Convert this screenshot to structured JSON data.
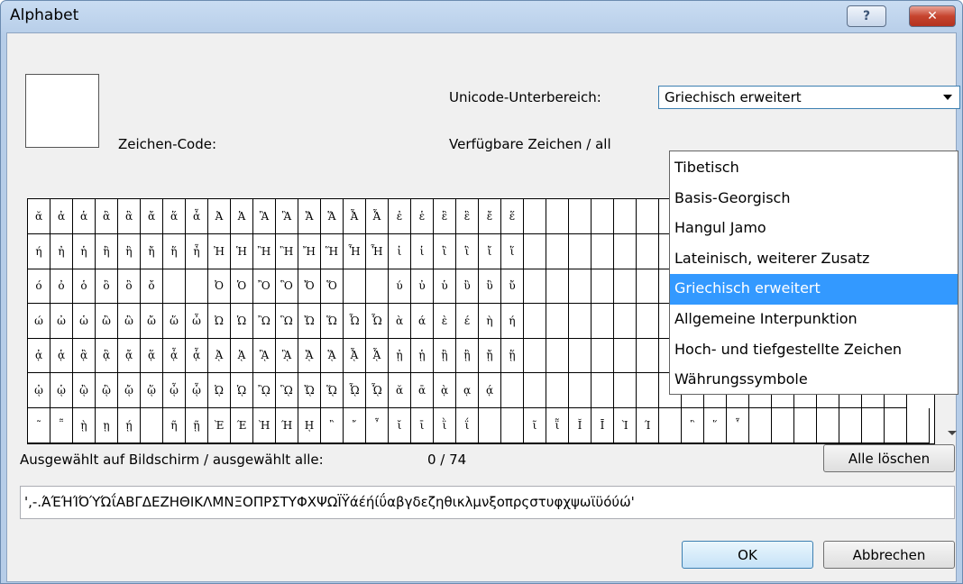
{
  "window": {
    "title": "Alphabet",
    "help_label": "?",
    "close_label": "✕"
  },
  "labels": {
    "unicode_label": "Unicode-Unterbereich:",
    "zeichen_code": "Zeichen-Code:",
    "verfuegbar": "Verfügbare Zeichen / all",
    "ausgewaehlt": "Ausgewählt auf Bildschirm / ausgewählt alle:",
    "count": "0 / 74"
  },
  "select": {
    "value": "Griechisch erweitert"
  },
  "dropdown": {
    "options": [
      "Tibetisch",
      "Basis-Georgisch",
      "Hangul Jamo",
      "Lateinisch, weiterer Zusatz",
      "Griechisch erweitert",
      "Allgemeine Interpunktion",
      "Hoch- und tiefgestellte Zeichen",
      "Währungssymbole"
    ],
    "selected_index": 4
  },
  "grid": {
    "rows": [
      [
        "ᾰ",
        "ἀ",
        "ἁ",
        "ἂ",
        "ἃ",
        "ἄ",
        "ἅ",
        "ἆ",
        "Ἀ",
        "Ἁ",
        "Ἂ",
        "Ἃ",
        "Ἄ",
        "Ἅ",
        "Ἆ",
        "Ἇ",
        "ἐ",
        "ἑ",
        "ἒ",
        "ἓ",
        "ἔ",
        "ἕ",
        "",
        "",
        "",
        "",
        "",
        "",
        "",
        "",
        "",
        "",
        "",
        "",
        "",
        "",
        "",
        "",
        "",
        ""
      ],
      [
        "ή",
        "ἠ",
        "ἡ",
        "ἢ",
        "ἣ",
        "ἤ",
        "ἥ",
        "ἦ",
        "Ἠ",
        "Ἡ",
        "Ἢ",
        "Ἣ",
        "Ἤ",
        "Ἥ",
        "Ἦ",
        "Ἧ",
        "ἰ",
        "ἱ",
        "ἲ",
        "ἳ",
        "ἴ",
        "ἵ",
        "",
        "",
        "",
        "",
        "",
        "",
        "",
        "",
        "",
        "",
        "",
        "",
        "",
        "",
        "",
        "",
        "",
        ""
      ],
      [
        "ό",
        "ὀ",
        "ὁ",
        "ὂ",
        "ὃ",
        "ὄ",
        "",
        "",
        "Ὀ",
        "Ὁ",
        "Ὂ",
        "Ὃ",
        "Ὄ",
        "Ὅ",
        "",
        "",
        "ύ",
        "ὐ",
        "ὑ",
        "ὒ",
        "ὓ",
        "ὔ",
        "",
        "",
        "",
        "",
        "",
        "",
        "",
        "",
        "",
        "",
        "",
        "",
        "",
        "",
        "",
        "",
        "",
        ""
      ],
      [
        "ώ",
        "ὠ",
        "ὡ",
        "ὢ",
        "ὣ",
        "ὤ",
        "ὥ",
        "ὦ",
        "Ὠ",
        "Ὡ",
        "Ὢ",
        "Ὣ",
        "Ὤ",
        "Ὥ",
        "Ὦ",
        "Ὧ",
        "ὰ",
        "ά",
        "ὲ",
        "έ",
        "ὴ",
        "ή",
        "",
        "",
        "",
        "",
        "",
        "",
        "",
        "",
        "",
        "",
        "",
        "",
        "",
        "",
        "",
        "",
        "",
        ""
      ],
      [
        "ᾀ",
        "ᾁ",
        "ᾂ",
        "ᾃ",
        "ᾄ",
        "ᾅ",
        "ᾆ",
        "ᾇ",
        "ᾈ",
        "ᾉ",
        "ᾊ",
        "ᾋ",
        "ᾌ",
        "ᾍ",
        "ᾎ",
        "ᾏ",
        "ᾐ",
        "ᾑ",
        "ᾒ",
        "ᾓ",
        "ᾔ",
        "ᾕ",
        "",
        "",
        "",
        "",
        "",
        "",
        "",
        "",
        "",
        "",
        "",
        "",
        "",
        "",
        "",
        "",
        "",
        ""
      ],
      [
        "ᾠ",
        "ᾡ",
        "ᾢ",
        "ᾣ",
        "ᾤ",
        "ᾥ",
        "ᾦ",
        "ᾧ",
        "ᾨ",
        "ᾩ",
        "ᾪ",
        "ᾫ",
        "ᾬ",
        "ᾭ",
        "ᾮ",
        "ᾯ",
        "ᾰ",
        "ᾱ",
        "ᾲ",
        "ᾳ",
        "ᾴ",
        "",
        "",
        "",
        "",
        "",
        "",
        "",
        "",
        "",
        "",
        "",
        "",
        "",
        "",
        "",
        "",
        "",
        ""
      ],
      [
        "῀",
        "῁",
        "ῂ",
        "ῃ",
        "ῄ",
        "",
        "ῆ",
        "ῇ",
        "Ὲ",
        "Έ",
        "Ὴ",
        "Ή",
        "ῌ",
        "῍",
        "῎",
        "῏",
        "ῐ",
        "ῑ",
        "ῒ",
        "ΐ",
        "",
        "",
        "ῖ",
        "ῗ",
        "Ῐ",
        "Ῑ",
        "Ὶ",
        "Ί",
        "",
        "῝",
        "῞",
        "῟",
        "",
        "",
        "",
        "",
        "",
        "",
        "",
        ""
      ]
    ]
  },
  "text_value": "',-.ΆΈΉΊΌΎΏΐΑΒΓΔΕΖΗΘΙΚΛΜΝΞΟΠΡΣΤΥΦΧΨΩΪΫάέήίΰαβγδεζηθικλμνξοπρςστυφχψωϊϋόύώ'",
  "buttons": {
    "clear_all": "Alle löschen",
    "ok": "OK",
    "cancel": "Abbrechen"
  }
}
